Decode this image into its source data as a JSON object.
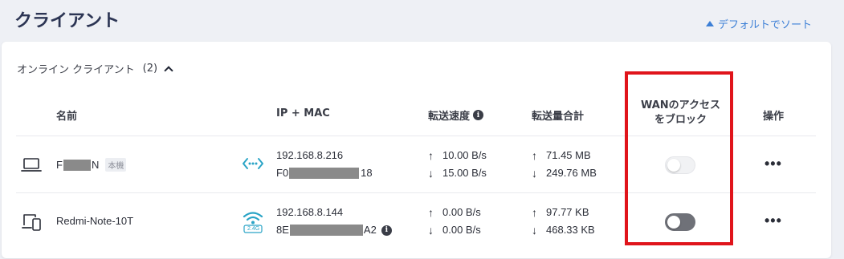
{
  "page": {
    "title": "クライアント",
    "sort_label": "デフォルトでソート"
  },
  "section": {
    "title": "オンライン クライアント",
    "count": "(2)"
  },
  "table": {
    "headers": {
      "name": "名前",
      "ip_mac": "IP + MAC",
      "speed": "転送速度",
      "total": "転送量合計",
      "wan_block_line1": "WANのアクセス",
      "wan_block_line2": "をブロック",
      "actions": "操作"
    },
    "rows": [
      {
        "name_start": "F",
        "name_end": "N",
        "tag": "本機",
        "device_icon": "laptop-icon",
        "connection_icon": "wired-connection-icon",
        "ip": "192.168.8.216",
        "mac_start": "F0",
        "mac_end": "18",
        "up_speed": "10.00 B/s",
        "down_speed": "15.00 B/s",
        "up_total": "71.45 MB",
        "down_total": "249.76 MB",
        "wan_blocked": false,
        "actions": "•••"
      },
      {
        "name": "Redmi-Note-10T",
        "device_icon": "phone-device-icon",
        "connection_icon": "wifi-2.4g-icon",
        "band_label": "2.4G",
        "ip": "192.168.8.144",
        "mac_start": "8E",
        "mac_end": "A2",
        "up_speed": "0.00 B/s",
        "down_speed": "0.00 B/s",
        "up_total": "97.77 KB",
        "down_total": "468.33 KB",
        "wan_blocked": true,
        "actions": "•••"
      }
    ]
  },
  "colors": {
    "accent": "#3c7fd6",
    "teal": "#2aa4c6",
    "highlight": "#e0141b"
  },
  "glyphs": {
    "info": "i",
    "arrow_up": "↑",
    "arrow_down": "↓"
  }
}
